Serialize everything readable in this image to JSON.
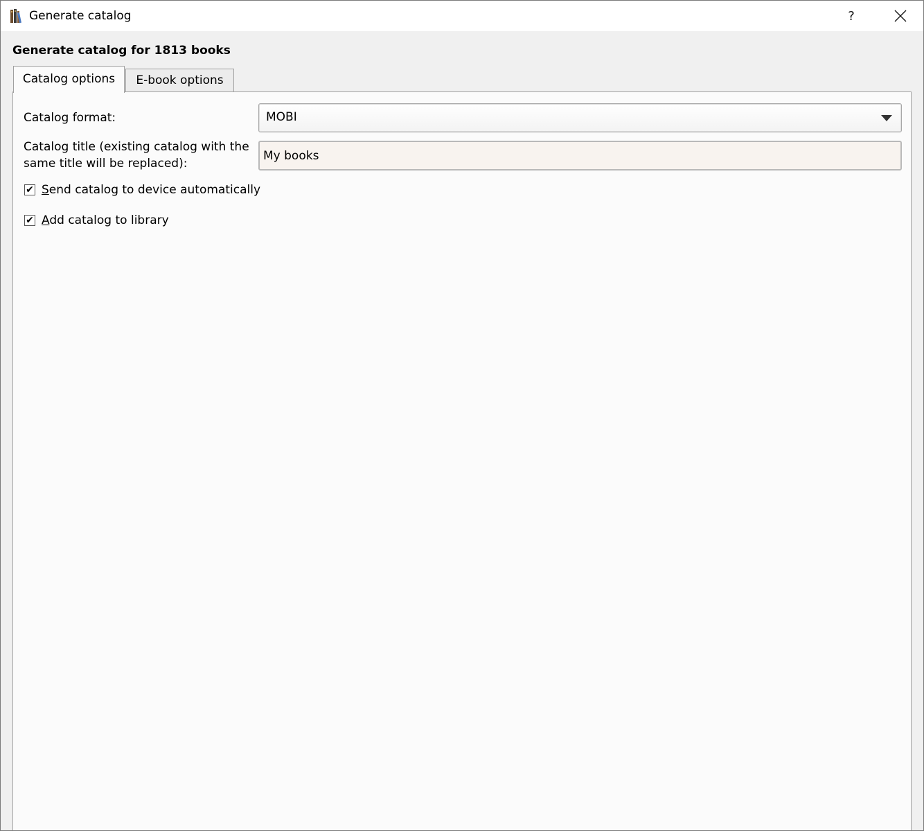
{
  "window": {
    "title": "Generate catalog",
    "help_label": "?"
  },
  "heading": "Generate catalog for 1813 books",
  "tabs": [
    {
      "label": "Catalog options",
      "active": true
    },
    {
      "label": "E-book options",
      "active": false
    }
  ],
  "catalog_options": {
    "format_label": "Catalog format:",
    "format_value": "MOBI",
    "title_label_line1": "Catalog title (existing catalog with the",
    "title_label_line2": "same title will be replaced):",
    "title_value": "My books",
    "checkboxes": [
      {
        "label": "Send catalog to device automatically",
        "checked": true
      },
      {
        "label": "Add catalog to library",
        "checked": true
      }
    ]
  },
  "colors": {
    "window_bg": "#f0f0f0",
    "panel_bg": "#fbfbfb",
    "input_bg": "#f8f3ef",
    "border": "#a0a0a0"
  }
}
